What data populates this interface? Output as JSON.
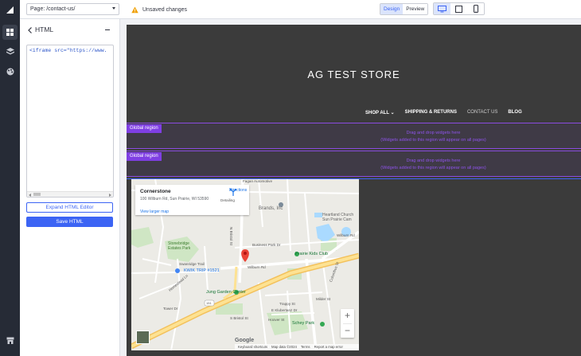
{
  "topbar": {
    "page_select": "Page: /contact-us/",
    "unsaved_text": "Unsaved changes",
    "design_label": "Design",
    "preview_label": "Preview",
    "view_mode": "Design",
    "device": "desktop"
  },
  "panel": {
    "title": "HTML",
    "code": "<iframe src=\"https://www.",
    "expand_label": "Expand HTML Editor",
    "save_label": "Save HTML"
  },
  "canvas": {
    "store_title": "AG TEST STORE",
    "nav": {
      "shop_all": "SHOP ALL",
      "shipping": "SHIPPING & RETURNS",
      "contact": "CONTACT US",
      "blog": "BLOG"
    },
    "regions": [
      {
        "tag": "Global region",
        "line1": "Drag and drop widgets here",
        "line2": "(Widgets added to this region will appear on all pages)"
      },
      {
        "tag": "Global region",
        "line1": "Drag and drop widgets here",
        "line2": "(Widgets added to this region will appear on all pages)"
      }
    ]
  },
  "map": {
    "place_name": "Cornerstone",
    "address": "100 Wilburn Rd, Sun Prairie, WI 53590",
    "directions_label": "Directions",
    "larger_map_label": "View larger map",
    "pois": {
      "prairie_kids": "Prairie Kids Club",
      "kwik_trip": "KWIK TRIP #1521",
      "jung": "Jung Garden Center",
      "schey": "Schey Park",
      "stonebridge": "Stonebridge Estates Park",
      "heartland": "Heartland Church Sun Prairie Cam",
      "brands": "Brands, Inc",
      "detailing": "Detailing",
      "fagan": "Fagan Automotive"
    },
    "streets": {
      "wilburn": "Wilburn Rd",
      "wilburn2": "Wilburn Rd",
      "bristol": "N Bristol St",
      "tower": "Tower Dr",
      "business_park": "Business Park Dr",
      "columbus": "Columbus St",
      "route": "151",
      "sbristol": "S Bristol St",
      "klubertanz": "E Klubertanz Dr",
      "hoover": "Hoover St",
      "milder": "Milder St",
      "trappy": "Trappy St",
      "swanridge": "Swanridge Trail",
      "homestead": "Homestead Ln"
    },
    "zoom_in": "+",
    "zoom_out": "−",
    "google": "Google",
    "footer": {
      "shortcuts": "Keyboard shortcuts",
      "data": "Map data ©2024",
      "terms": "Terms",
      "report": "Report a map error"
    }
  },
  "colors": {
    "accent": "#3c64f4",
    "region": "#8a4be0",
    "rail": "#262b36",
    "canvas": "#3b3b3b"
  }
}
